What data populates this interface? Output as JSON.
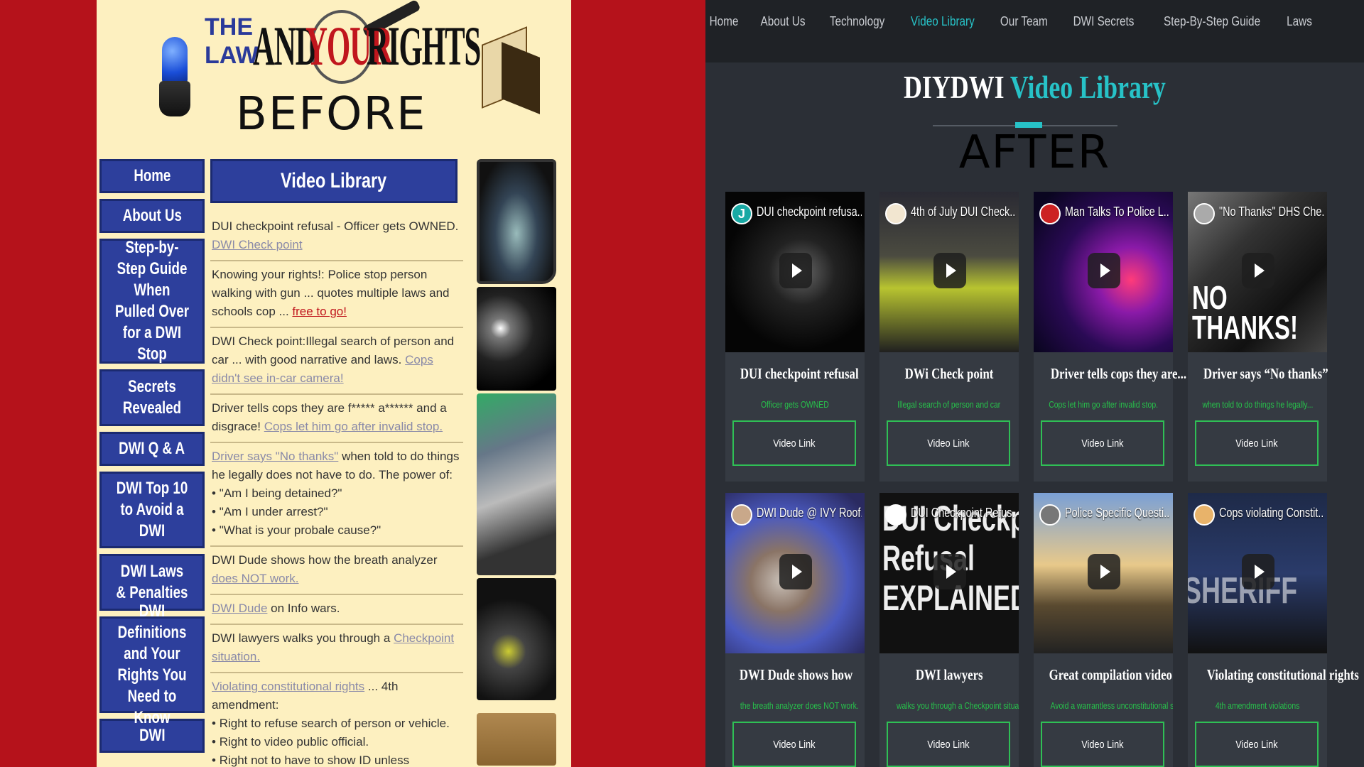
{
  "before": {
    "logo": {
      "the_law": "THE\nLAW",
      "and": "AND",
      "your": "YOUR",
      "rights": "RIGHTS"
    },
    "label": "BEFORE",
    "nav": [
      "Home",
      "About Us",
      "Step-by-Step Guide When Pulled Over for a DWI Stop",
      "Secrets Revealed",
      "DWI Q & A",
      "DWI Top 10 to Avoid a DWI",
      "DWI Laws & Penalties",
      "DWI Definitions and Your Rights You Need to Know",
      "DWI"
    ],
    "header": "Video Library",
    "items": [
      {
        "text": "DUI checkpoint refusal - Officer gets OWNED.",
        "link": "DWI Check point"
      },
      {
        "text": "Knowing your rights!: Police stop person walking with gun ... quotes multiple laws and schools cop ...",
        "link": "free to go!"
      },
      {
        "text": "DWI Check point:Illegal search of person and car ... with good narrative and laws.",
        "link": "Cops didn't see in-car camera!"
      },
      {
        "text": "Driver tells cops they are f***** a****** and a disgrace!",
        "link": "Cops let him go after invalid stop."
      },
      {
        "lead_link": "Driver says \"No thanks\"",
        "text": "when told to do things he legally does not have to do. The power of:",
        "bullets": [
          "\"Am I being detained?\"",
          "\"Am I under arrest?\"",
          "\"What is your probale cause?\""
        ]
      },
      {
        "text": "DWI Dude shows how the breath analyzer",
        "link": "does NOT work."
      },
      {
        "lead_link": "DWI Dude",
        "text": "on Info wars."
      },
      {
        "text": "DWI lawyers walks you through a",
        "link": "Checkpoint situation."
      },
      {
        "lead_link": "Violating constitutional rights",
        "text": "... 4th amendment:",
        "bullets": [
          "Right to refuse search of person or vehicle.",
          "Right to video public official.",
          "Right not to have to show ID unless suspected of commiting a crime."
        ]
      }
    ]
  },
  "after": {
    "nav": [
      "Home",
      "About Us",
      "Technology",
      "Video Library",
      "Our Team",
      "DWI Secrets",
      "Step-By-Step Guide",
      "Laws"
    ],
    "active_nav": "Video Library",
    "title_a": "DIYDWI",
    "title_b": "Video Library",
    "label": "AFTER",
    "accent_color": "#27c2c7",
    "button_color": "#2fbf55",
    "cards": [
      {
        "video_title": "DUI checkpoint refusa...",
        "title": "DUI checkpoint refusal",
        "subtitle": "Officer gets OWNED",
        "button": "Video Link",
        "channel": "J"
      },
      {
        "video_title": "4th of July DUI Check...",
        "title": "DWi Check point",
        "subtitle": "Illegal search of person and car",
        "button": "Video Link"
      },
      {
        "video_title": "Man Talks To Police L...",
        "title": "Driver tells cops they are...",
        "subtitle": "Cops let him go after invalid stop.",
        "button": "Video Link"
      },
      {
        "video_title": "\"No Thanks\" DHS Che...",
        "title": "Driver says “No thanks”",
        "subtitle": "when told to do things he legally...",
        "button": "Video Link",
        "overlay": "NO\nTHANKS!"
      },
      {
        "video_title": "DWI Dude @ IVY Roof...",
        "title": "DWI Dude shows how",
        "subtitle": "the breath analyzer does NOT work.",
        "button": "Video Link"
      },
      {
        "video_title": "DUI Checkpoint Refus...",
        "title": "DWI lawyers",
        "subtitle": "walks you through a Checkpoint situation.",
        "button": "Video Link",
        "overlay": "DUI Checkpoint\nRefusal\nEXPLAINED"
      },
      {
        "video_title": "Police Specific Questi...",
        "title": "Great compilation video",
        "subtitle": "Avoid a warrantless unconstitutional stop",
        "button": "Video Link"
      },
      {
        "video_title": "Cops violating Constit...",
        "title": "Violating constitutional rights",
        "subtitle": "4th amendment violations",
        "button": "Video Link",
        "overlay": "SHERIFF"
      }
    ]
  }
}
